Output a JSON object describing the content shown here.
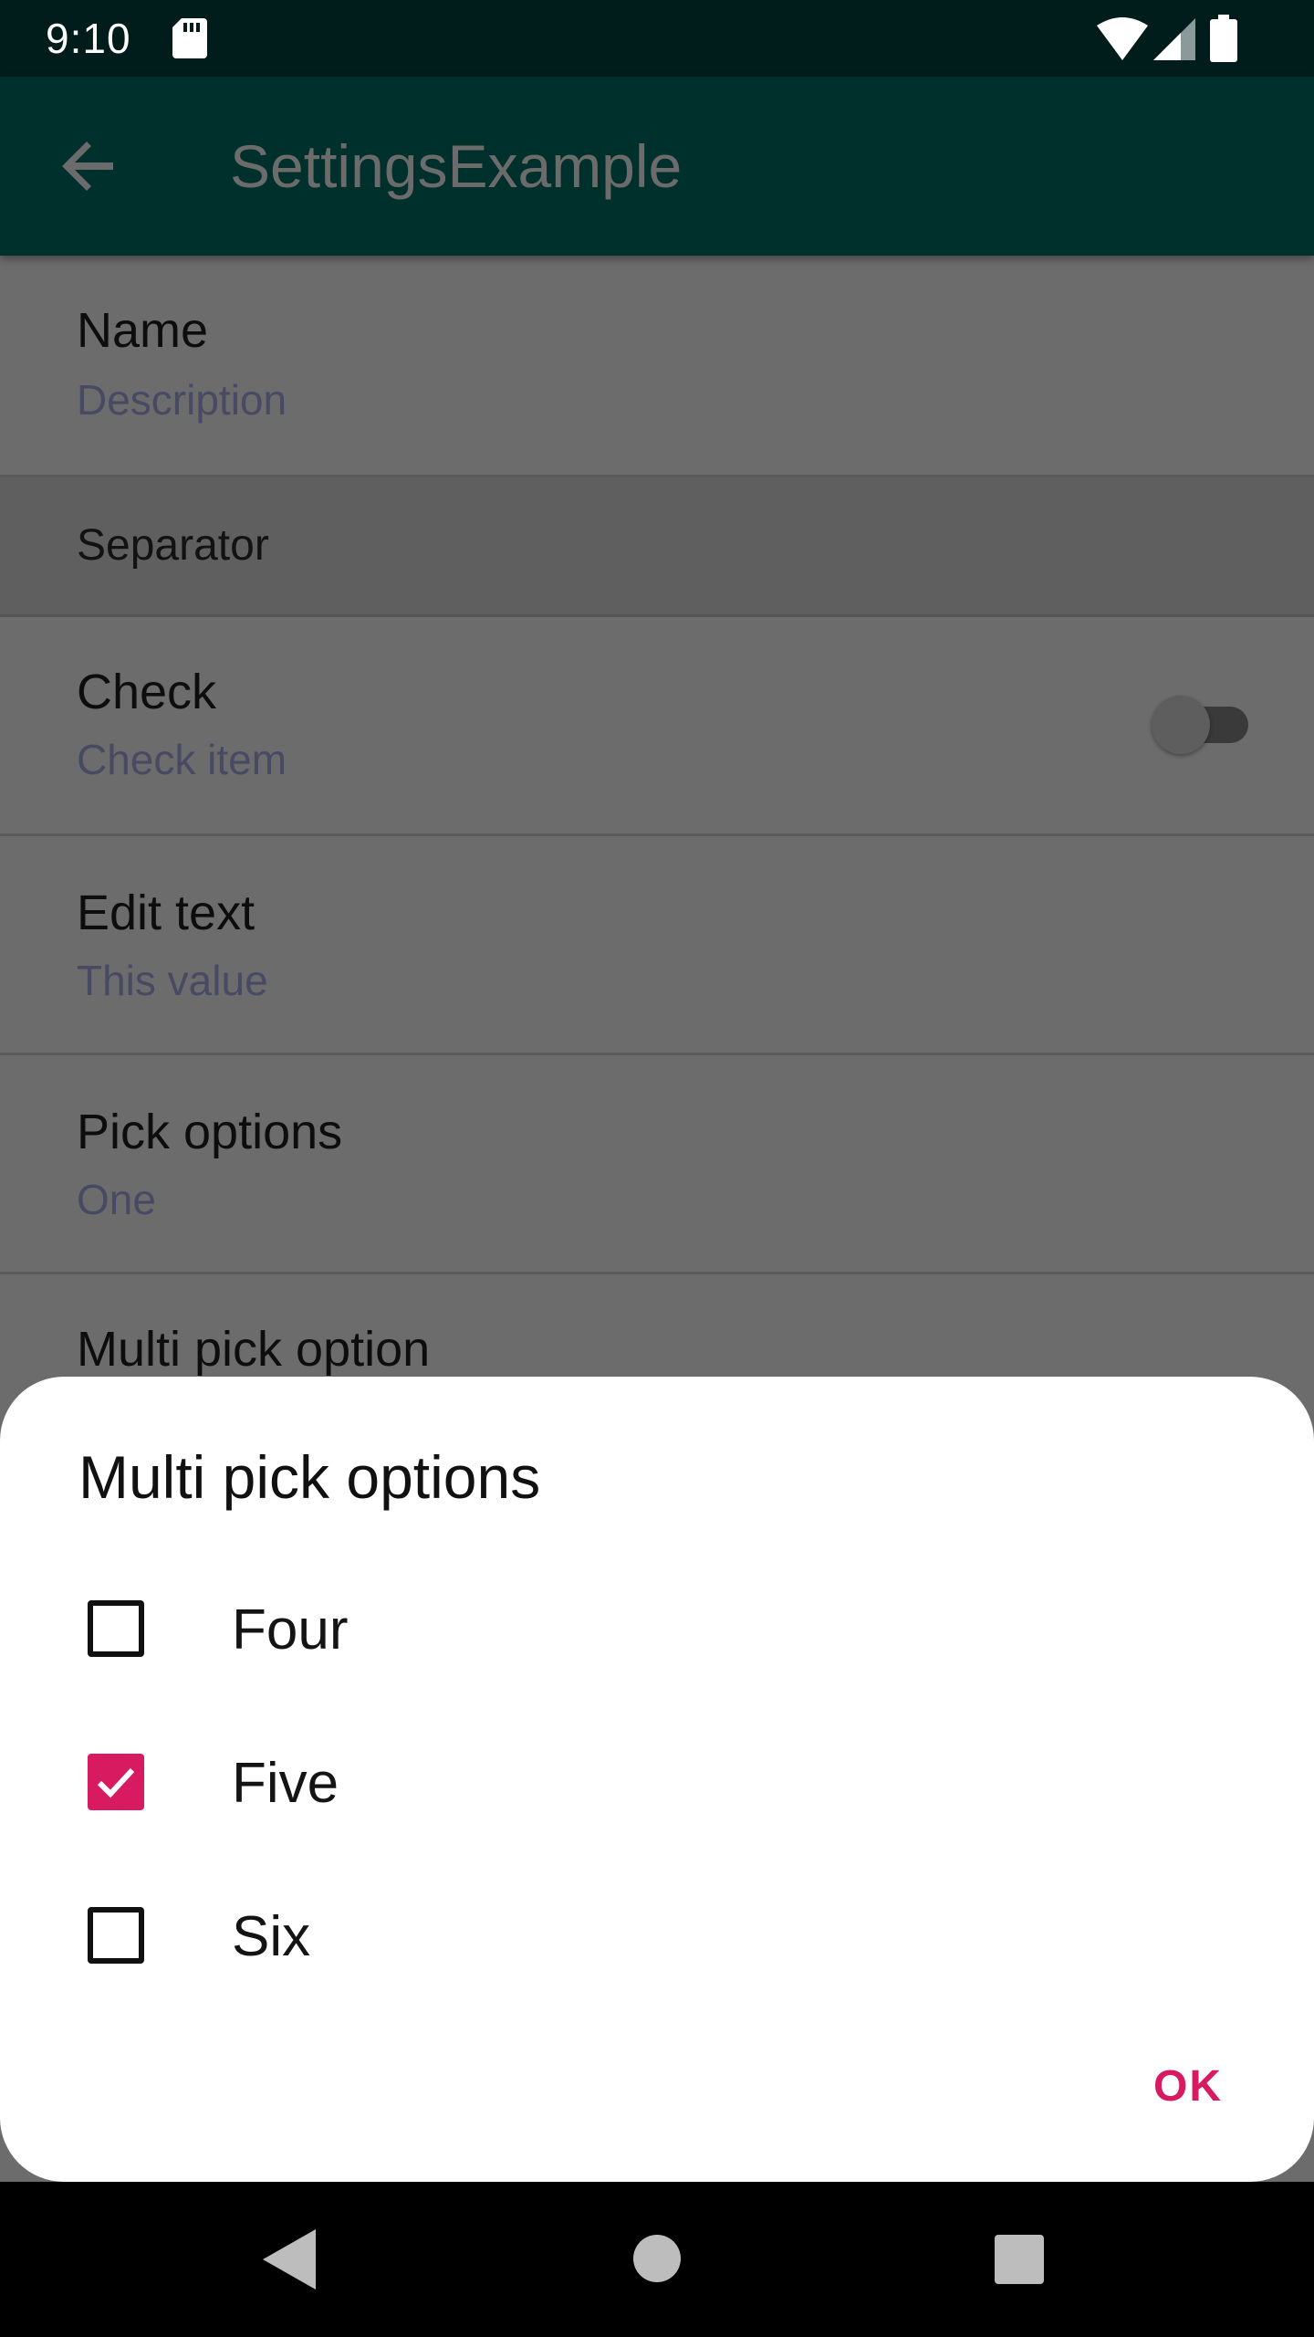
{
  "status_bar": {
    "time": "9:10",
    "icons": [
      "sd-card-icon",
      "wifi-icon",
      "signal-icon",
      "battery-icon"
    ]
  },
  "app_bar": {
    "title": "SettingsExample",
    "back_icon": "arrow-back-icon"
  },
  "settings": {
    "name": {
      "title": "Name",
      "summary": "Description"
    },
    "separator": {
      "label": "Separator"
    },
    "check": {
      "title": "Check",
      "summary": "Check item",
      "enabled": false
    },
    "edit_text": {
      "title": "Edit text",
      "summary": "This value"
    },
    "pick_options": {
      "title": "Pick options",
      "summary": "One"
    },
    "multi_pick": {
      "title": "Multi pick option"
    }
  },
  "dialog": {
    "title": "Multi pick options",
    "options": [
      {
        "label": "Four",
        "checked": false
      },
      {
        "label": "Five",
        "checked": true
      },
      {
        "label": "Six",
        "checked": false
      }
    ],
    "ok_label": "OK"
  },
  "colors": {
    "status_bar": "#001d1b",
    "app_bar": "#00302b",
    "accent": "#d81b60",
    "scrim_content": "#6c6c6c"
  },
  "nav_bar": {
    "icons": [
      "nav-back-icon",
      "nav-home-icon",
      "nav-recents-icon"
    ]
  }
}
